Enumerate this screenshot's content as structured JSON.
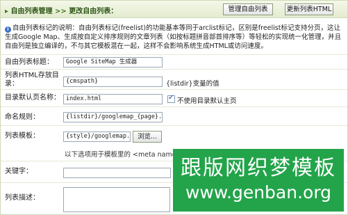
{
  "header": {
    "title": "自由列表管理",
    "subtitle": "更改自由列表：",
    "manage_button": "管理自由列表",
    "update_button": "更新列表HTML"
  },
  "description": "自由列表标记的说明：自由列表标记(freelist)的功能基本等同于arclist标记，区别是freelist标记支持分页，这让生成Google Map、生成按自定义排序规则的文章列表（如按标题拼音部首排序等）等轻松的实现统一化管理，并且自由列是独立编译的，不与其它模板混在一起，这样不会影响系统生成HTML或访问速度。",
  "form": {
    "title_label": "自由列表标题：",
    "title_value": "Google SiteMap 生成器",
    "dir_label": "列表HTML存放目录：",
    "dir_value": "{cmspath}",
    "dir_hint": "{listdir}变量的值",
    "default_page_label": "目录默认页名称：",
    "default_page_value": "index.html",
    "default_page_hint": "不使用目录默认主页",
    "rule_label": "命名规则：",
    "rule_value": "{listdir}/googlemap_{page}.xml",
    "template_label": "列表模板：",
    "template_value": "{style}/googlemap.htm",
    "browse_button": "浏览...",
    "meta_hint": "以下选项用于模板里的 <meta name=\"keywords\"",
    "keywords_label": "关键字：",
    "desc_label": "列表描述："
  },
  "watermark": {
    "cn": "跟版网织梦模板",
    "en": "www.genban.org"
  },
  "colors": {
    "header_text": "#2c5414",
    "watermark_bg": "#23a44a"
  }
}
